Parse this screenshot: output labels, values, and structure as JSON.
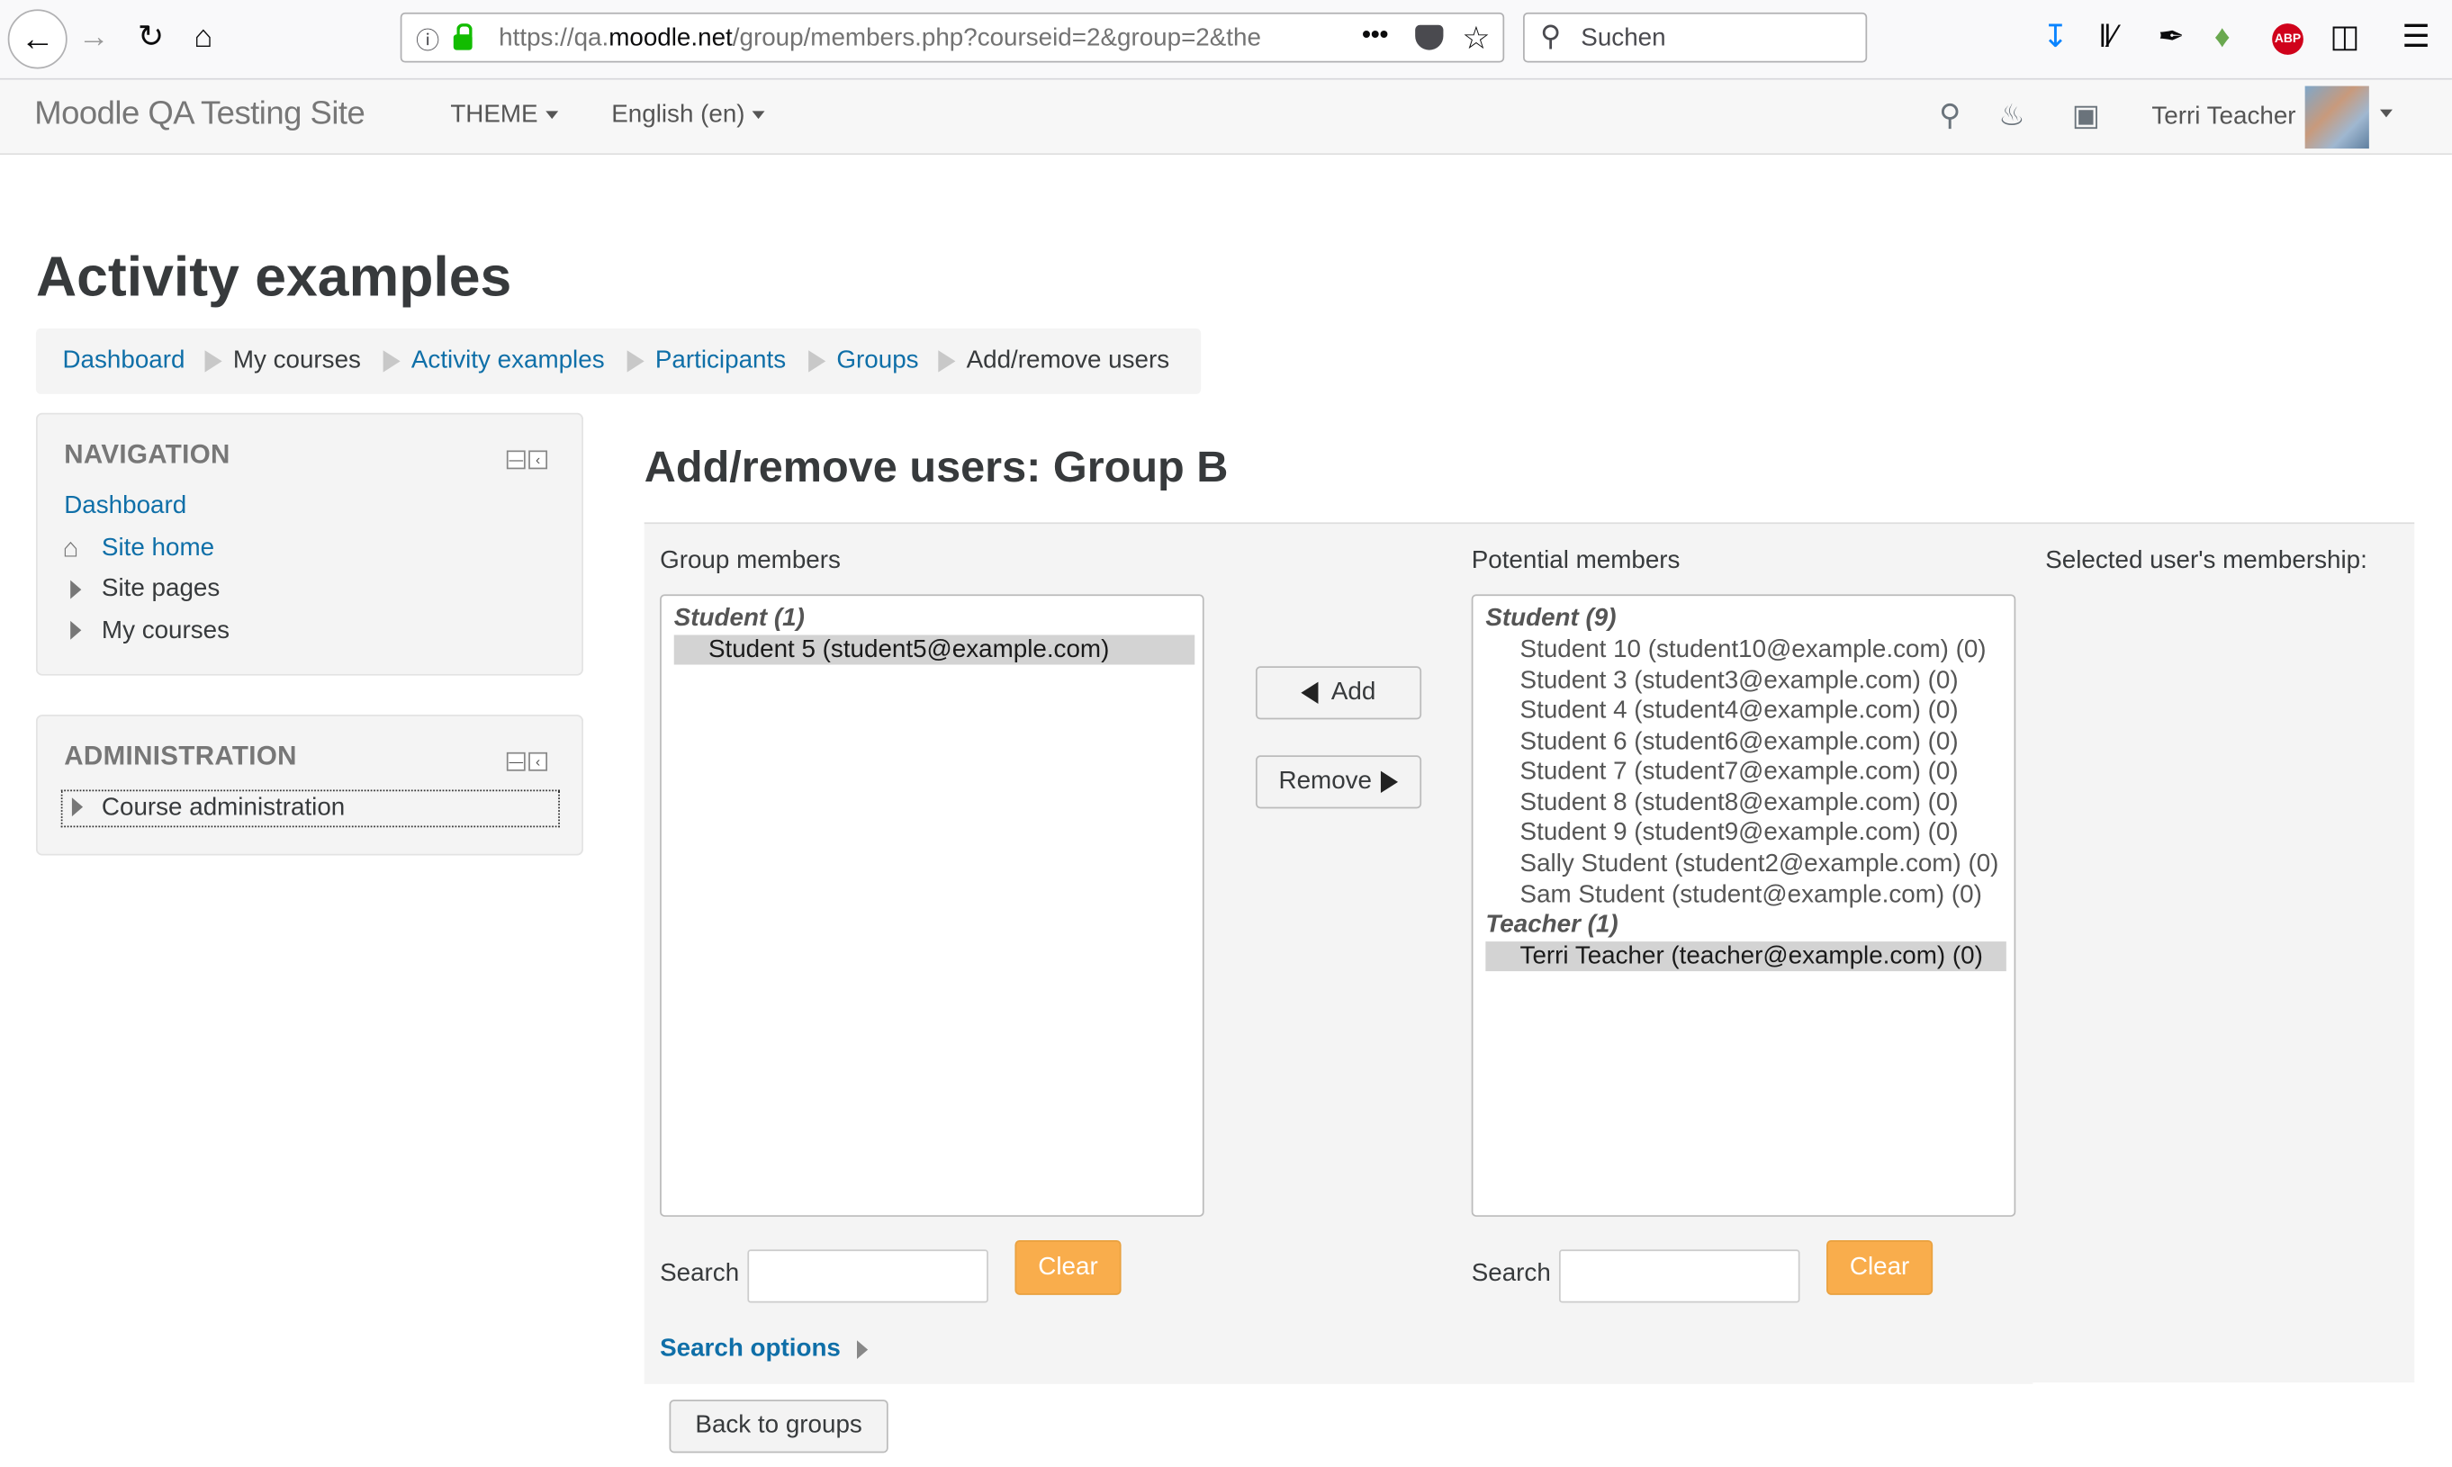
{
  "browser": {
    "url_host_prefix": "https://qa.",
    "url_host": "moodle.net",
    "url_path": "/group/members.php?courseid=2&group=2&the",
    "search_placeholder": "Suchen"
  },
  "navbar": {
    "site_name": "Moodle QA Testing Site",
    "theme_menu": "THEME",
    "language_menu": "English (en)",
    "user_name": "Terri Teacher"
  },
  "page": {
    "title": "Activity examples",
    "breadcrumb": [
      "Dashboard",
      "My courses",
      "Activity examples",
      "Participants",
      "Groups",
      "Add/remove users"
    ]
  },
  "navigation_block": {
    "title": "NAVIGATION",
    "items": [
      "Dashboard",
      "Site home",
      "Site pages",
      "My courses"
    ]
  },
  "administration_block": {
    "title": "ADMINISTRATION",
    "items": [
      "Course administration"
    ]
  },
  "main": {
    "heading": "Add/remove users: Group B",
    "group_members_label": "Group members",
    "potential_members_label": "Potential members",
    "membership_label": "Selected user's membership:",
    "group_members": {
      "groups": [
        {
          "label": "Student (1)",
          "options": [
            {
              "text": "Student 5 (student5@example.com)",
              "selected": true
            }
          ]
        }
      ]
    },
    "potential_members": {
      "groups": [
        {
          "label": "Student (9)",
          "options": [
            {
              "text": "Student 10 (student10@example.com) (0)",
              "selected": false
            },
            {
              "text": "Student 3 (student3@example.com) (0)",
              "selected": false
            },
            {
              "text": "Student 4 (student4@example.com) (0)",
              "selected": false
            },
            {
              "text": "Student 6 (student6@example.com) (0)",
              "selected": false
            },
            {
              "text": "Student 7 (student7@example.com) (0)",
              "selected": false
            },
            {
              "text": "Student 8 (student8@example.com) (0)",
              "selected": false
            },
            {
              "text": "Student 9 (student9@example.com) (0)",
              "selected": false
            },
            {
              "text": "Sally Student (student2@example.com) (0)",
              "selected": false
            },
            {
              "text": "Sam Student (student@example.com) (0)",
              "selected": false
            }
          ]
        },
        {
          "label": "Teacher (1)",
          "options": [
            {
              "text": "Terri Teacher (teacher@example.com) (0)",
              "selected": true
            }
          ]
        }
      ]
    },
    "add_button": "Add",
    "remove_button": "Remove",
    "search_label": "Search",
    "clear_button": "Clear",
    "search_options": "Search options",
    "back_button": "Back to groups"
  },
  "colors": {
    "link": "#0f6fa8",
    "clear_button": "#f9ad4c"
  }
}
